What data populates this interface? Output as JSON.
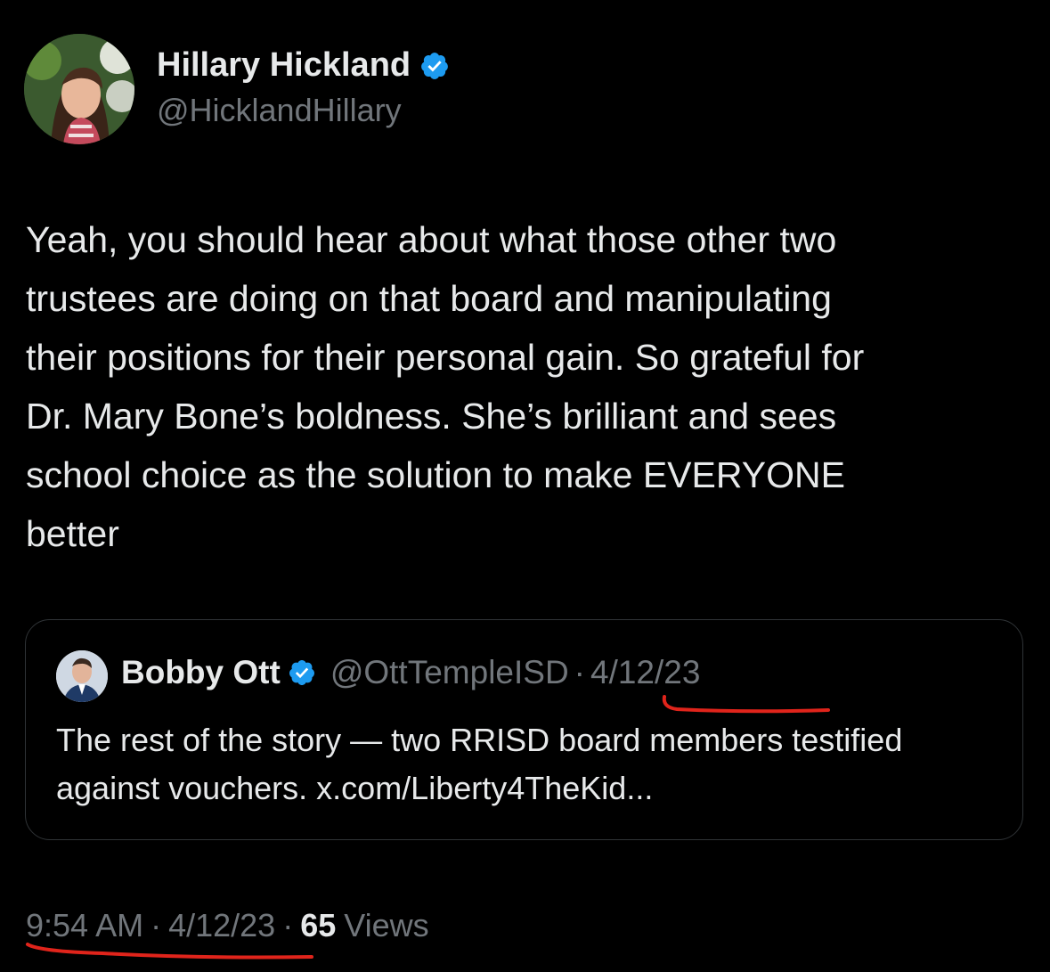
{
  "tweet": {
    "author_name": "Hillary Hickland",
    "author_handle": "@HicklandHillary",
    "text": "Yeah, you should hear about what those other two\ntrustees are doing on that board and manipulating\ntheir positions for their personal gain. So grateful for\nDr. Mary Bone’s boldness. She’s brilliant and sees\nschool choice as the solution to make EVERYONE\nbetter",
    "time": "9:54 AM",
    "date": "4/12/23",
    "views_count": "65",
    "views_label": "Views"
  },
  "quote": {
    "author_name": "Bobby Ott",
    "author_handle": "@OttTempleISD",
    "separator": "·",
    "date": "4/12/23",
    "text": "The rest of the story — two RRISD board members testified against vouchers. x.com/Liberty4TheKid..."
  },
  "meta_separator": "·",
  "colors": {
    "background": "#000000",
    "text_primary": "#e7e9ea",
    "text_secondary": "#71767b",
    "verified_badge": "#1d9bf0",
    "annotation_underline": "#e0241b"
  },
  "icons": {
    "verified": "verified-badge-icon"
  }
}
